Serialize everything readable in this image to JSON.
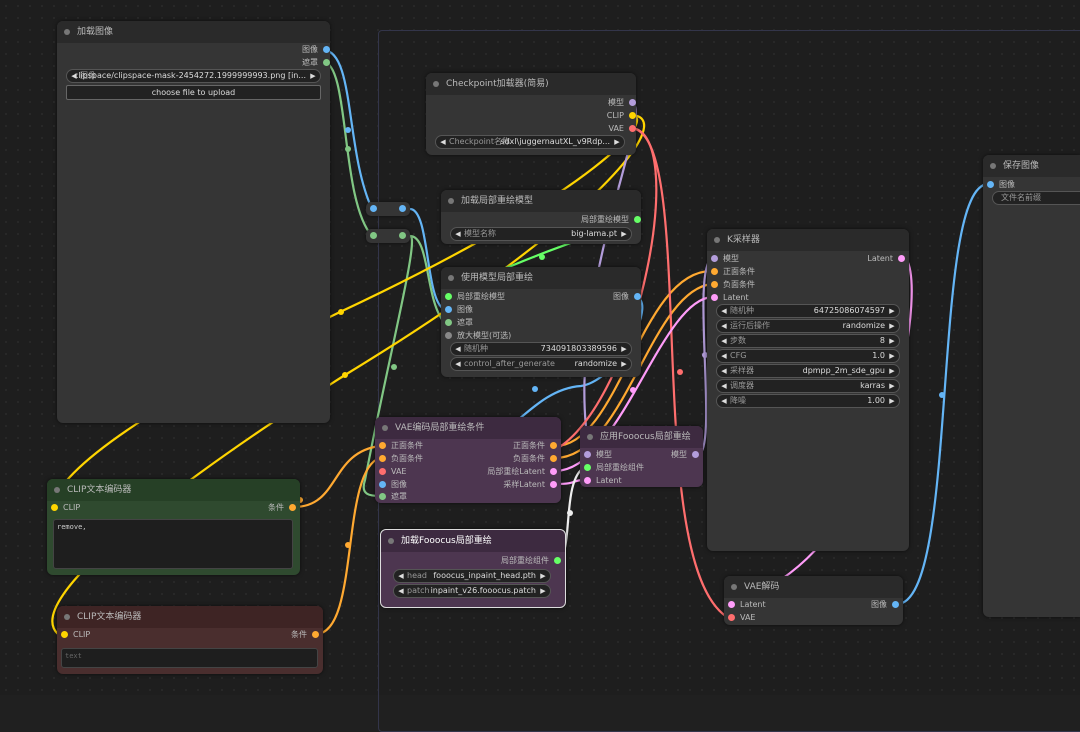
{
  "colors": {
    "image": "#64b5f6",
    "mask": "#81c784",
    "model": "#b39ddb",
    "clip": "#ffd500",
    "vae": "#ff6e6e",
    "conditioning": "#ffa931",
    "latent": "#ff9cf9",
    "inpaint_model": "#66ff66"
  },
  "load_image": {
    "title": "加载图像",
    "outputs": [
      "图像",
      "遮罩"
    ],
    "image_widget": {
      "label": "图像",
      "value": "clipspace/clipspace-mask-2454272.1999999993.png [in..."
    },
    "upload_button": "choose file to upload"
  },
  "checkpoint": {
    "title": "Checkpoint加载器(简易)",
    "outputs": [
      "模型",
      "CLIP",
      "VAE"
    ],
    "widget": {
      "label": "Checkpoint名称",
      "value": "sdxl\\juggernautXL_v9Rdp..."
    }
  },
  "load_inpaint_model": {
    "title": "加载局部重绘模型",
    "output": "局部重绘模型",
    "widget": {
      "label": "模型名称",
      "value": "big-lama.pt"
    }
  },
  "use_inpaint": {
    "title": "使用模型局部重绘",
    "inputs": [
      "局部重绘模型",
      "图像",
      "遮罩",
      "放大模型(可选)"
    ],
    "output": "图像",
    "seed": {
      "label": "随机种",
      "value": "734091803389596"
    },
    "control": {
      "label": "control_after_generate",
      "value": "randomize"
    }
  },
  "ksampler": {
    "title": "K采样器",
    "inputs": [
      "模型",
      "正面条件",
      "负面条件",
      "Latent"
    ],
    "output": "Latent",
    "widgets": [
      {
        "label": "随机种",
        "value": "647250860745​97"
      },
      {
        "label": "运行后操作",
        "value": "randomize"
      },
      {
        "label": "步数",
        "value": "8"
      },
      {
        "label": "CFG",
        "value": "1.0"
      },
      {
        "label": "采样器",
        "value": "dpmpp_2m_sde_gpu"
      },
      {
        "label": "调度器",
        "value": "karras"
      },
      {
        "label": "降噪",
        "value": "1.00"
      }
    ]
  },
  "save_image": {
    "title": "保存图像",
    "input": "图像",
    "prefix_label": "文件名前缀"
  },
  "vae_encode_inpaint": {
    "title": "VAE编码局部重绘条件",
    "inputs": [
      "正面条件",
      "负面条件",
      "VAE",
      "图像",
      "遮罩"
    ],
    "outputs": [
      "正面条件",
      "负面条件",
      "局部重绘Latent",
      "采样Latent"
    ]
  },
  "apply_fooocus": {
    "title": "应用Fooocus局部重绘",
    "inputs": [
      "模型",
      "局部重绘组件",
      "Latent"
    ],
    "output": "模型"
  },
  "load_fooocus": {
    "title": "加载Fooocus局部重绘",
    "output": "局部重绘组件",
    "head": {
      "label": "head",
      "value": "fooocus_inpaint_head.pth"
    },
    "patch": {
      "label": "patch",
      "value": "inpaint_v26.fooocus.patch"
    }
  },
  "vae_decode": {
    "title": "VAE解码",
    "inputs": [
      "Latent",
      "VAE"
    ],
    "output": "图像"
  },
  "clip_pos": {
    "title": "CLIP文本编码器",
    "input": "CLIP",
    "output": "条件",
    "text": "remove,"
  },
  "clip_neg": {
    "title": "CLIP文本编码器",
    "input": "CLIP",
    "output": "条件",
    "placeholder": "text"
  }
}
